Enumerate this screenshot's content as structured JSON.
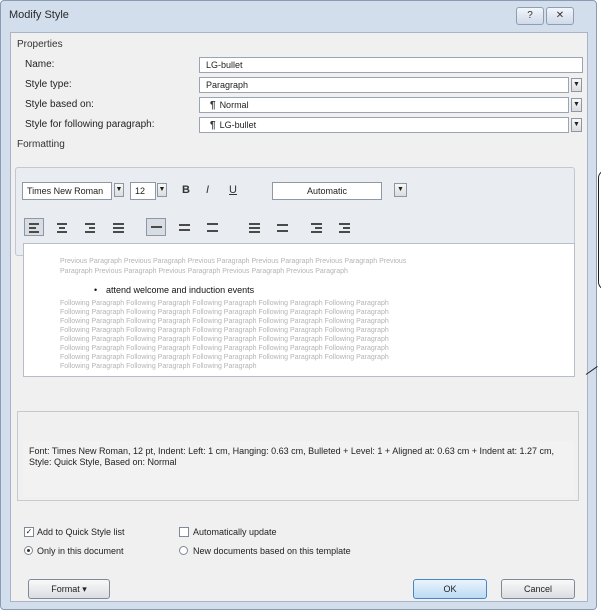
{
  "window": {
    "title": "Modify Style",
    "help_label": "?",
    "close_label": "✕"
  },
  "properties": {
    "section_label": "Properties",
    "name": {
      "label": "Name:",
      "value": "LG-bullet"
    },
    "style_type": {
      "label": "Style type:",
      "value": "Paragraph"
    },
    "based_on": {
      "label": "Style based on:",
      "value": "Normal"
    },
    "following": {
      "label": "Style for following paragraph:",
      "value": "LG-bullet"
    }
  },
  "formatting": {
    "section_label": "Formatting",
    "font": "Times New Roman",
    "size": "12",
    "bold": "B",
    "italic": "I",
    "underline": "U",
    "color": "Automatic"
  },
  "preview": {
    "prev_lines": [
      "Previous Paragraph Previous Paragraph Previous Paragraph Previous Paragraph Previous Paragraph Previous",
      "Paragraph Previous Paragraph Previous Paragraph Previous Paragraph Previous Paragraph"
    ],
    "bullet": "•",
    "main_text": "attend welcome and induction events",
    "follow_lines": [
      "Following Paragraph Following Paragraph Following Paragraph Following Paragraph Following Paragraph",
      "Following Paragraph Following Paragraph Following Paragraph Following Paragraph Following Paragraph",
      "Following Paragraph Following Paragraph Following Paragraph Following Paragraph Following Paragraph",
      "Following Paragraph Following Paragraph Following Paragraph Following Paragraph Following Paragraph",
      "Following Paragraph Following Paragraph Following Paragraph Following Paragraph Following Paragraph",
      "Following Paragraph Following Paragraph Following Paragraph Following Paragraph Following Paragraph",
      "Following Paragraph Following Paragraph Following Paragraph Following Paragraph Following Paragraph",
      "Following Paragraph Following Paragraph Following Paragraph"
    ]
  },
  "description": "Font: Times New Roman, 12 pt, Indent: Left: 1 cm, Hanging: 0.63 cm, Bulleted + Level: 1 + Aligned at: 0.63 cm + Indent at: 1.27 cm, Style: Quick Style, Based on: Normal",
  "options": {
    "add_quick_style": "Add to Quick Style list",
    "auto_update": "Automatically update",
    "only_this_doc": "Only in this document",
    "new_docs": "New documents based on this template"
  },
  "buttons": {
    "format": "Format ▾",
    "ok": "OK",
    "cancel": "Cancel"
  }
}
